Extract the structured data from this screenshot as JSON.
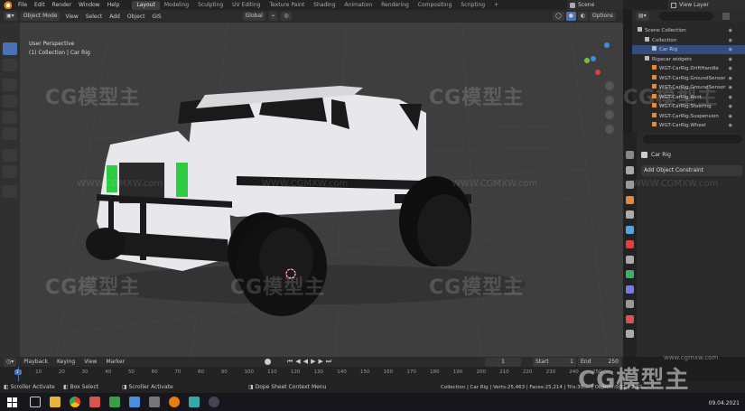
{
  "menus": [
    "File",
    "Edit",
    "Render",
    "Window",
    "Help"
  ],
  "workspaces": [
    "Layout",
    "Modeling",
    "Sculpting",
    "UV Editing",
    "Texture Paint",
    "Shading",
    "Animation",
    "Rendering",
    "Compositing",
    "Scripting"
  ],
  "active_workspace": "Layout",
  "add_tab": "+",
  "scene_label": "Scene",
  "view_layer_label": "View Layer",
  "viewport_header": {
    "mode": "Object Mode",
    "menus": [
      "View",
      "Select",
      "Add",
      "Object",
      "GIS"
    ],
    "transform": "Global",
    "options": "Options"
  },
  "viewport": {
    "perspective": "User Perspective",
    "collection": "(1) Collection | Car Rig"
  },
  "outliner": {
    "rows": [
      {
        "label": "Scene Collection",
        "indent": 0,
        "sel": false
      },
      {
        "label": "Collection",
        "indent": 1,
        "sel": false
      },
      {
        "label": "Car Rig",
        "indent": 2,
        "sel": true
      },
      {
        "label": "Rigacar widgets",
        "indent": 1,
        "sel": false
      },
      {
        "label": "WGT-CarRig.DriftHandle",
        "indent": 2,
        "sel": false
      },
      {
        "label": "WGT-CarRig.GroundSensor",
        "indent": 2,
        "sel": false
      },
      {
        "label": "WGT-CarRig.GroundSensor",
        "indent": 2,
        "sel": false
      },
      {
        "label": "WGT-CarRig.Root",
        "indent": 2,
        "sel": false
      },
      {
        "label": "WGT-CarRig.Steering",
        "indent": 2,
        "sel": false
      },
      {
        "label": "WGT-CarRig.Suspension",
        "indent": 2,
        "sel": false
      },
      {
        "label": "WGT-CarRig.Wheel",
        "indent": 2,
        "sel": false
      }
    ]
  },
  "properties": {
    "object": "Car Rig",
    "add_constraint": "Add Object Constraint"
  },
  "timeline": {
    "menus": [
      "Playback",
      "Keying",
      "View",
      "Marker"
    ],
    "frame": "1",
    "start_label": "Start",
    "start": "1",
    "end_label": "End",
    "end": "250",
    "ticks": [
      "1",
      "10",
      "20",
      "30",
      "40",
      "50",
      "60",
      "70",
      "80",
      "90",
      "100",
      "110",
      "120",
      "130",
      "140",
      "150",
      "160",
      "170",
      "180",
      "190",
      "200",
      "210",
      "220",
      "230",
      "240",
      "250"
    ]
  },
  "statusbar": {
    "items": [
      "Scroller Activate",
      "Box Select",
      "Scroller Activate",
      "Dope Sheet Context Menu"
    ],
    "stats": "Collection | Car Rig | Verts:25,463 | Faces:25,214 | Tris:35,... | Objects:0/21 | 2.92..."
  },
  "taskbar": {
    "date": "09.04.2021"
  },
  "watermarks": [
    "CG模型主",
    "CG模型主",
    "CG模型主",
    "CG模型主",
    "CG模型主",
    "CG模型主"
  ],
  "watermark_small": [
    "WWW.CGMXW.com",
    "WWW.CGMXW.com",
    "WWW.CGMXW.com",
    "WWW.CGMXW.com"
  ],
  "corner_watermark": "CG模型主",
  "corner_url": "www.cgmxw.com",
  "colors": {
    "accent": "#4772b3",
    "headlight": "#2ecc40",
    "car_body": "#e8e8ec",
    "outliner_sel": "#334d80"
  }
}
